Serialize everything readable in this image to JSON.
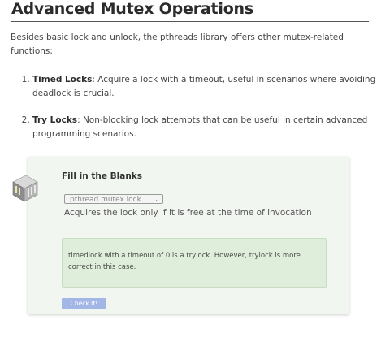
{
  "section": {
    "title": "Advanced Mutex Operations",
    "intro": "Besides basic lock and unlock, the pthreads library offers other mutex-related functions:",
    "items": [
      {
        "term": "Timed Locks",
        "text": ": Acquire a lock with a timeout, useful in scenarios where avoiding deadlock is crucial."
      },
      {
        "term": "Try Locks",
        "text": ": Non-blocking lock attempts that can be useful in certain advanced programming scenarios."
      }
    ]
  },
  "exercise": {
    "icon": "server-rack-icon",
    "title": "Fill in the Blanks",
    "select_value": "pthread mutex lock",
    "description": "Acquires the lock only if it is free at the time of invocation",
    "feedback": "timedlock with a timeout of 0 is a trylock. However, trylock is more correct in this case.",
    "check_label": "Check It!",
    "colors": {
      "card_bg": "#f2f6f1",
      "feedback_bg": "#dfeeda",
      "button_bg": "#a3b7e6"
    }
  }
}
